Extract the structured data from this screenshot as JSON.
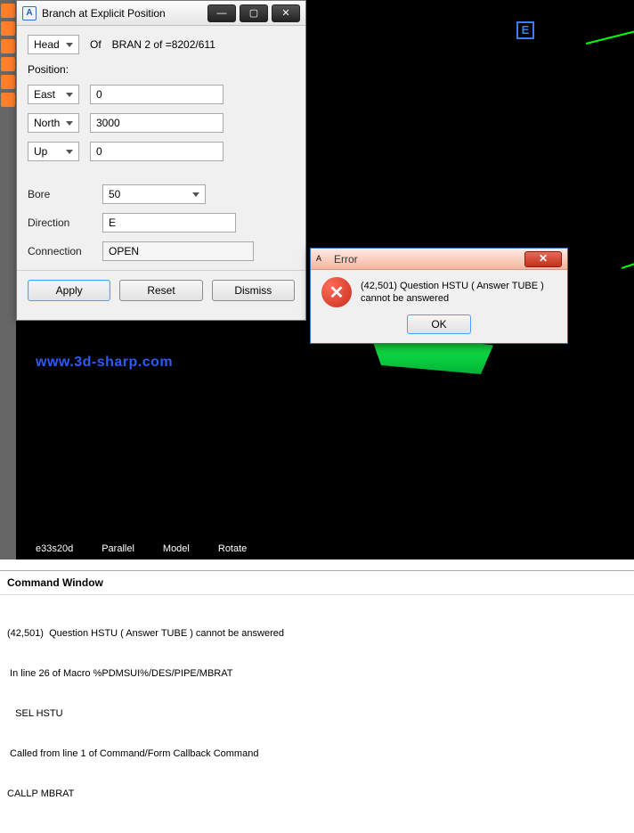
{
  "left_strip": {
    "icon_count": 6
  },
  "viewport": {
    "e_badge": "E",
    "watermark": "www.3d-sharp.com",
    "status_items": [
      "e33s20d",
      "Parallel",
      "Model",
      "Rotate"
    ]
  },
  "branch_dialog": {
    "title": "Branch at Explicit Position",
    "app_icon_glyph": "A",
    "winbtns": {
      "min": "—",
      "max": "▢",
      "close": "✕"
    },
    "head_select": "Head",
    "of_label": "Of",
    "bran_label": "BRAN 2 of =8202/611",
    "position_label": "Position:",
    "rows": [
      {
        "axis": "East",
        "value": "0"
      },
      {
        "axis": "North",
        "value": "3000"
      },
      {
        "axis": "Up",
        "value": "0"
      }
    ],
    "bore_label": "Bore",
    "bore_value": "50",
    "direction_label": "Direction",
    "direction_value": "E",
    "connection_label": "Connection",
    "connection_value": "OPEN",
    "buttons": {
      "apply": "Apply",
      "reset": "Reset",
      "dismiss": "Dismiss"
    }
  },
  "error_dialog": {
    "title": "Error",
    "app_icon_glyph": "A",
    "close_glyph": "✕",
    "icon_glyph": "✕",
    "message_l1": "(42,501)  Question  HSTU ( Answer TUBE )",
    "message_l2": "cannot be answered",
    "ok": "OK"
  },
  "command_window": {
    "title": "Command Window",
    "lines": [
      "(42,501)  Question HSTU ( Answer TUBE ) cannot be answered",
      " In line 26 of Macro %PDMSUI%/DES/PIPE/MBRAT",
      "   SEL HSTU",
      " Called from line 1 of Command/Form Callback Command",
      "CALLP MBRAT"
    ]
  }
}
